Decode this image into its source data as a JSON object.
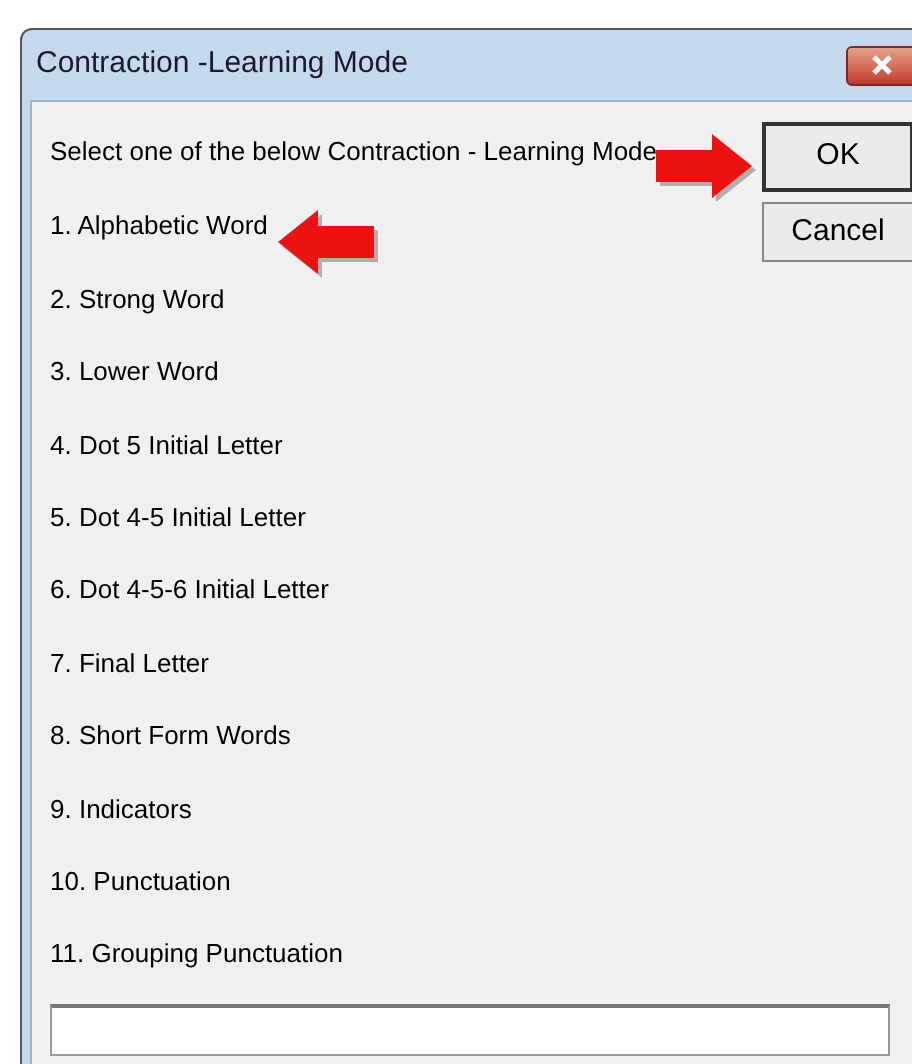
{
  "window": {
    "title": "Contraction -Learning Mode"
  },
  "prompt": "Select one of the below Contraction - Learning Mode",
  "options": [
    "1. Alphabetic Word",
    "2. Strong Word",
    "3. Lower Word",
    "4. Dot 5 Initial Letter",
    "5. Dot 4-5 Initial Letter",
    "6. Dot 4-5-6 Initial Letter",
    "7. Final Letter",
    "8. Short Form Words",
    "9. Indicators",
    "10. Punctuation",
    "11. Grouping Punctuation"
  ],
  "buttons": [
    {
      "label": "OK",
      "selected": true
    },
    {
      "label": "Cancel",
      "selected": false
    }
  ]
}
